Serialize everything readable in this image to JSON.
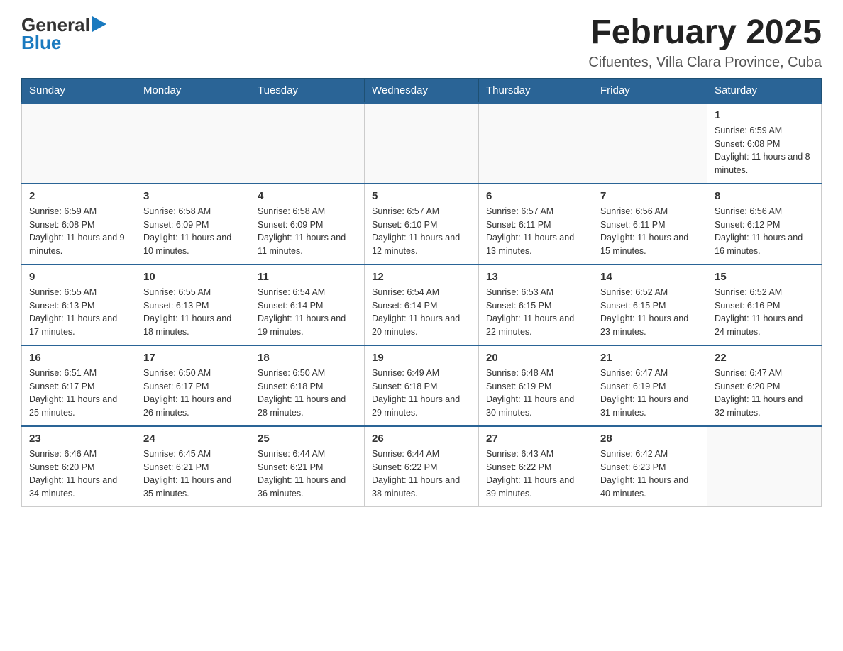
{
  "logo": {
    "text_general": "General",
    "text_blue": "Blue",
    "arrow_unicode": "▶"
  },
  "title": "February 2025",
  "subtitle": "Cifuentes, Villa Clara Province, Cuba",
  "weekdays": [
    "Sunday",
    "Monday",
    "Tuesday",
    "Wednesday",
    "Thursday",
    "Friday",
    "Saturday"
  ],
  "weeks": [
    {
      "days": [
        {
          "date": "",
          "info": ""
        },
        {
          "date": "",
          "info": ""
        },
        {
          "date": "",
          "info": ""
        },
        {
          "date": "",
          "info": ""
        },
        {
          "date": "",
          "info": ""
        },
        {
          "date": "",
          "info": ""
        },
        {
          "date": "1",
          "info": "Sunrise: 6:59 AM\nSunset: 6:08 PM\nDaylight: 11 hours and 8 minutes."
        }
      ]
    },
    {
      "days": [
        {
          "date": "2",
          "info": "Sunrise: 6:59 AM\nSunset: 6:08 PM\nDaylight: 11 hours and 9 minutes."
        },
        {
          "date": "3",
          "info": "Sunrise: 6:58 AM\nSunset: 6:09 PM\nDaylight: 11 hours and 10 minutes."
        },
        {
          "date": "4",
          "info": "Sunrise: 6:58 AM\nSunset: 6:09 PM\nDaylight: 11 hours and 11 minutes."
        },
        {
          "date": "5",
          "info": "Sunrise: 6:57 AM\nSunset: 6:10 PM\nDaylight: 11 hours and 12 minutes."
        },
        {
          "date": "6",
          "info": "Sunrise: 6:57 AM\nSunset: 6:11 PM\nDaylight: 11 hours and 13 minutes."
        },
        {
          "date": "7",
          "info": "Sunrise: 6:56 AM\nSunset: 6:11 PM\nDaylight: 11 hours and 15 minutes."
        },
        {
          "date": "8",
          "info": "Sunrise: 6:56 AM\nSunset: 6:12 PM\nDaylight: 11 hours and 16 minutes."
        }
      ]
    },
    {
      "days": [
        {
          "date": "9",
          "info": "Sunrise: 6:55 AM\nSunset: 6:13 PM\nDaylight: 11 hours and 17 minutes."
        },
        {
          "date": "10",
          "info": "Sunrise: 6:55 AM\nSunset: 6:13 PM\nDaylight: 11 hours and 18 minutes."
        },
        {
          "date": "11",
          "info": "Sunrise: 6:54 AM\nSunset: 6:14 PM\nDaylight: 11 hours and 19 minutes."
        },
        {
          "date": "12",
          "info": "Sunrise: 6:54 AM\nSunset: 6:14 PM\nDaylight: 11 hours and 20 minutes."
        },
        {
          "date": "13",
          "info": "Sunrise: 6:53 AM\nSunset: 6:15 PM\nDaylight: 11 hours and 22 minutes."
        },
        {
          "date": "14",
          "info": "Sunrise: 6:52 AM\nSunset: 6:15 PM\nDaylight: 11 hours and 23 minutes."
        },
        {
          "date": "15",
          "info": "Sunrise: 6:52 AM\nSunset: 6:16 PM\nDaylight: 11 hours and 24 minutes."
        }
      ]
    },
    {
      "days": [
        {
          "date": "16",
          "info": "Sunrise: 6:51 AM\nSunset: 6:17 PM\nDaylight: 11 hours and 25 minutes."
        },
        {
          "date": "17",
          "info": "Sunrise: 6:50 AM\nSunset: 6:17 PM\nDaylight: 11 hours and 26 minutes."
        },
        {
          "date": "18",
          "info": "Sunrise: 6:50 AM\nSunset: 6:18 PM\nDaylight: 11 hours and 28 minutes."
        },
        {
          "date": "19",
          "info": "Sunrise: 6:49 AM\nSunset: 6:18 PM\nDaylight: 11 hours and 29 minutes."
        },
        {
          "date": "20",
          "info": "Sunrise: 6:48 AM\nSunset: 6:19 PM\nDaylight: 11 hours and 30 minutes."
        },
        {
          "date": "21",
          "info": "Sunrise: 6:47 AM\nSunset: 6:19 PM\nDaylight: 11 hours and 31 minutes."
        },
        {
          "date": "22",
          "info": "Sunrise: 6:47 AM\nSunset: 6:20 PM\nDaylight: 11 hours and 32 minutes."
        }
      ]
    },
    {
      "days": [
        {
          "date": "23",
          "info": "Sunrise: 6:46 AM\nSunset: 6:20 PM\nDaylight: 11 hours and 34 minutes."
        },
        {
          "date": "24",
          "info": "Sunrise: 6:45 AM\nSunset: 6:21 PM\nDaylight: 11 hours and 35 minutes."
        },
        {
          "date": "25",
          "info": "Sunrise: 6:44 AM\nSunset: 6:21 PM\nDaylight: 11 hours and 36 minutes."
        },
        {
          "date": "26",
          "info": "Sunrise: 6:44 AM\nSunset: 6:22 PM\nDaylight: 11 hours and 38 minutes."
        },
        {
          "date": "27",
          "info": "Sunrise: 6:43 AM\nSunset: 6:22 PM\nDaylight: 11 hours and 39 minutes."
        },
        {
          "date": "28",
          "info": "Sunrise: 6:42 AM\nSunset: 6:23 PM\nDaylight: 11 hours and 40 minutes."
        },
        {
          "date": "",
          "info": ""
        }
      ]
    }
  ]
}
